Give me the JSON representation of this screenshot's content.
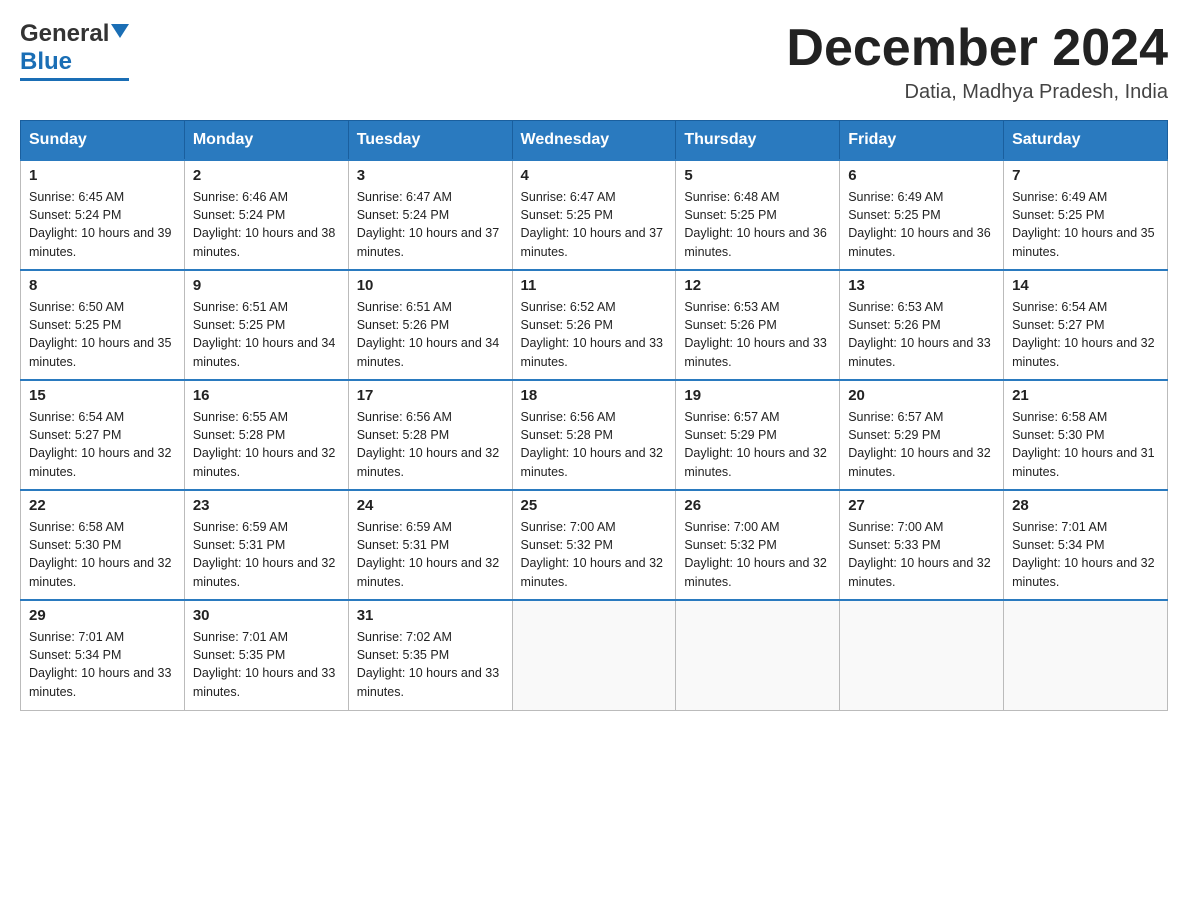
{
  "logo": {
    "general": "General",
    "blue": "Blue"
  },
  "title": "December 2024",
  "location": "Datia, Madhya Pradesh, India",
  "days_of_week": [
    "Sunday",
    "Monday",
    "Tuesday",
    "Wednesday",
    "Thursday",
    "Friday",
    "Saturday"
  ],
  "weeks": [
    [
      {
        "day": "1",
        "sunrise": "6:45 AM",
        "sunset": "5:24 PM",
        "daylight": "10 hours and 39 minutes."
      },
      {
        "day": "2",
        "sunrise": "6:46 AM",
        "sunset": "5:24 PM",
        "daylight": "10 hours and 38 minutes."
      },
      {
        "day": "3",
        "sunrise": "6:47 AM",
        "sunset": "5:24 PM",
        "daylight": "10 hours and 37 minutes."
      },
      {
        "day": "4",
        "sunrise": "6:47 AM",
        "sunset": "5:25 PM",
        "daylight": "10 hours and 37 minutes."
      },
      {
        "day": "5",
        "sunrise": "6:48 AM",
        "sunset": "5:25 PM",
        "daylight": "10 hours and 36 minutes."
      },
      {
        "day": "6",
        "sunrise": "6:49 AM",
        "sunset": "5:25 PM",
        "daylight": "10 hours and 36 minutes."
      },
      {
        "day": "7",
        "sunrise": "6:49 AM",
        "sunset": "5:25 PM",
        "daylight": "10 hours and 35 minutes."
      }
    ],
    [
      {
        "day": "8",
        "sunrise": "6:50 AM",
        "sunset": "5:25 PM",
        "daylight": "10 hours and 35 minutes."
      },
      {
        "day": "9",
        "sunrise": "6:51 AM",
        "sunset": "5:25 PM",
        "daylight": "10 hours and 34 minutes."
      },
      {
        "day": "10",
        "sunrise": "6:51 AM",
        "sunset": "5:26 PM",
        "daylight": "10 hours and 34 minutes."
      },
      {
        "day": "11",
        "sunrise": "6:52 AM",
        "sunset": "5:26 PM",
        "daylight": "10 hours and 33 minutes."
      },
      {
        "day": "12",
        "sunrise": "6:53 AM",
        "sunset": "5:26 PM",
        "daylight": "10 hours and 33 minutes."
      },
      {
        "day": "13",
        "sunrise": "6:53 AM",
        "sunset": "5:26 PM",
        "daylight": "10 hours and 33 minutes."
      },
      {
        "day": "14",
        "sunrise": "6:54 AM",
        "sunset": "5:27 PM",
        "daylight": "10 hours and 32 minutes."
      }
    ],
    [
      {
        "day": "15",
        "sunrise": "6:54 AM",
        "sunset": "5:27 PM",
        "daylight": "10 hours and 32 minutes."
      },
      {
        "day": "16",
        "sunrise": "6:55 AM",
        "sunset": "5:28 PM",
        "daylight": "10 hours and 32 minutes."
      },
      {
        "day": "17",
        "sunrise": "6:56 AM",
        "sunset": "5:28 PM",
        "daylight": "10 hours and 32 minutes."
      },
      {
        "day": "18",
        "sunrise": "6:56 AM",
        "sunset": "5:28 PM",
        "daylight": "10 hours and 32 minutes."
      },
      {
        "day": "19",
        "sunrise": "6:57 AM",
        "sunset": "5:29 PM",
        "daylight": "10 hours and 32 minutes."
      },
      {
        "day": "20",
        "sunrise": "6:57 AM",
        "sunset": "5:29 PM",
        "daylight": "10 hours and 32 minutes."
      },
      {
        "day": "21",
        "sunrise": "6:58 AM",
        "sunset": "5:30 PM",
        "daylight": "10 hours and 31 minutes."
      }
    ],
    [
      {
        "day": "22",
        "sunrise": "6:58 AM",
        "sunset": "5:30 PM",
        "daylight": "10 hours and 32 minutes."
      },
      {
        "day": "23",
        "sunrise": "6:59 AM",
        "sunset": "5:31 PM",
        "daylight": "10 hours and 32 minutes."
      },
      {
        "day": "24",
        "sunrise": "6:59 AM",
        "sunset": "5:31 PM",
        "daylight": "10 hours and 32 minutes."
      },
      {
        "day": "25",
        "sunrise": "7:00 AM",
        "sunset": "5:32 PM",
        "daylight": "10 hours and 32 minutes."
      },
      {
        "day": "26",
        "sunrise": "7:00 AM",
        "sunset": "5:32 PM",
        "daylight": "10 hours and 32 minutes."
      },
      {
        "day": "27",
        "sunrise": "7:00 AM",
        "sunset": "5:33 PM",
        "daylight": "10 hours and 32 minutes."
      },
      {
        "day": "28",
        "sunrise": "7:01 AM",
        "sunset": "5:34 PM",
        "daylight": "10 hours and 32 minutes."
      }
    ],
    [
      {
        "day": "29",
        "sunrise": "7:01 AM",
        "sunset": "5:34 PM",
        "daylight": "10 hours and 33 minutes."
      },
      {
        "day": "30",
        "sunrise": "7:01 AM",
        "sunset": "5:35 PM",
        "daylight": "10 hours and 33 minutes."
      },
      {
        "day": "31",
        "sunrise": "7:02 AM",
        "sunset": "5:35 PM",
        "daylight": "10 hours and 33 minutes."
      },
      null,
      null,
      null,
      null
    ]
  ],
  "labels": {
    "sunrise": "Sunrise: ",
    "sunset": "Sunset: ",
    "daylight": "Daylight: "
  }
}
